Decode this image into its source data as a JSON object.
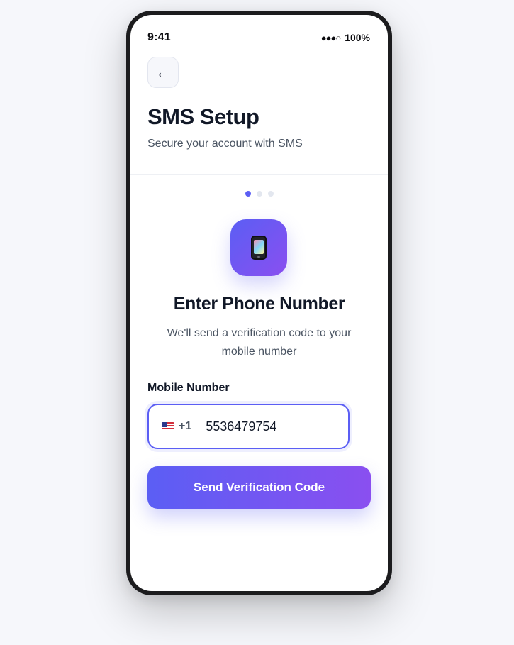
{
  "status_bar": {
    "time": "9:41",
    "signal": "●●●○",
    "battery": "100%"
  },
  "header": {
    "back_icon": "←",
    "title": "SMS Setup",
    "subtitle": "Secure your account with SMS"
  },
  "progress": {
    "current_step": 1,
    "total_steps": 3
  },
  "step": {
    "icon": "mobile-phone-icon",
    "title": "Enter Phone Number",
    "description": "We'll send a verification code to your mobile number"
  },
  "form": {
    "label": "Mobile Number",
    "country_flag": "us-flag-icon",
    "country_code": "+1",
    "phone_value": "5536479754"
  },
  "actions": {
    "send_label": "Send Verification Code"
  },
  "colors": {
    "accent": "#5b5ef4",
    "accent_end": "#8a4ff0",
    "title_text": "#111827",
    "body_text": "#4b5563"
  }
}
